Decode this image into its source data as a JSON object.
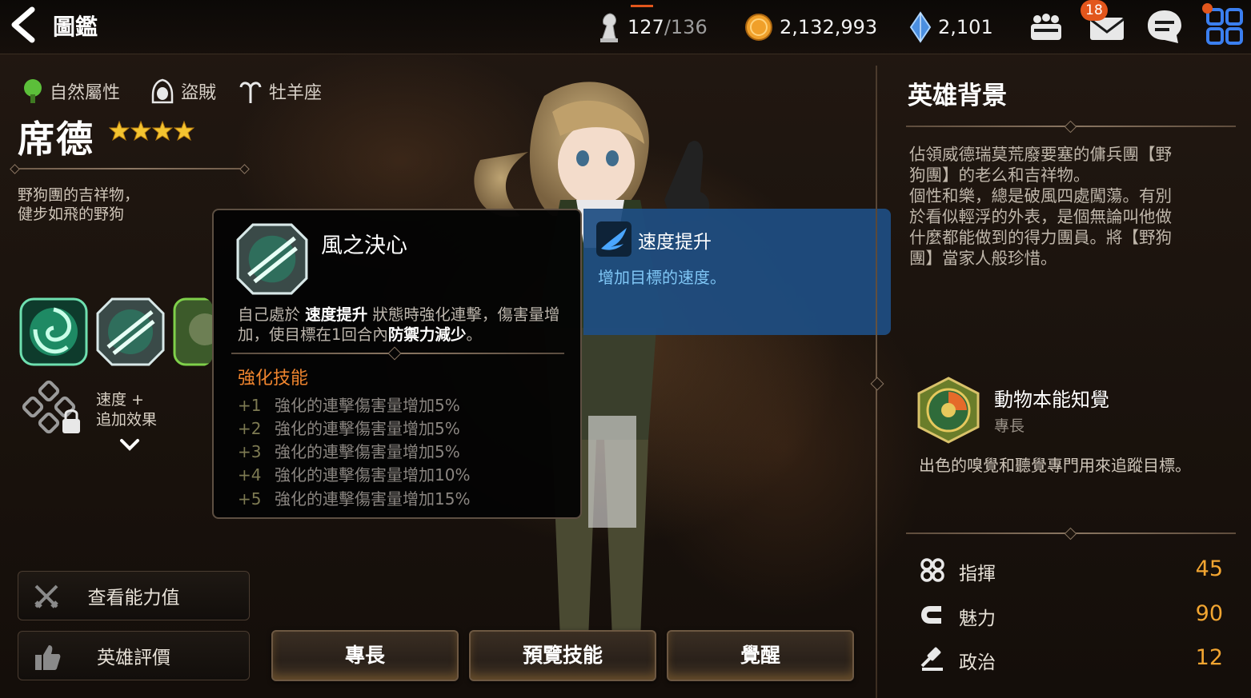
{
  "header": {
    "back_label": "back",
    "title": "圖鑑",
    "stamina": {
      "current": "127",
      "max": "/136"
    },
    "gold": "2,132,993",
    "crystal": "2,101",
    "mail_badge": "18"
  },
  "hero": {
    "attribute": "自然屬性",
    "class": "盜賊",
    "zodiac": "牡羊座",
    "name": "席德",
    "stars": 4,
    "tagline_lines": [
      "野狗團的吉祥物，",
      "健步如飛的野狗"
    ]
  },
  "skill_panel": {
    "buff_hint_lines": [
      "速度 +",
      "追加效果"
    ]
  },
  "side_buttons": {
    "stats": "查看能力值",
    "review": "英雄評價"
  },
  "bottom_tabs": {
    "specialty": "專長",
    "preview_skill": "預覽技能",
    "awaken": "覺醒"
  },
  "tooltip": {
    "skill_name": "風之決心",
    "desc_parts": {
      "p1": "自己處於 ",
      "b1": "速度提升",
      "p2": " 狀態時強化連擊，傷害量增加，使目標在1回合內",
      "b2": "防禦力減少",
      "p3": "。"
    },
    "enhance_title": "強化技能",
    "levels": [
      {
        "plus": "+1",
        "text": "強化的連擊傷害量增加5%"
      },
      {
        "plus": "+2",
        "text": "強化的連擊傷害量增加5%"
      },
      {
        "plus": "+3",
        "text": "強化的連擊傷害量增加5%"
      },
      {
        "plus": "+4",
        "text": "強化的連擊傷害量增加10%"
      },
      {
        "plus": "+5",
        "text": "強化的連擊傷害量增加15%"
      }
    ]
  },
  "buff_popup": {
    "title": "速度提升",
    "desc": "增加目標的速度。"
  },
  "right_panel": {
    "title": "英雄背景",
    "bio_lines": [
      "佔領威德瑞莫荒廢要塞的傭兵團【野",
      "狗團】的老么和吉祥物。",
      "個性和樂，總是破風四處闖蕩。有別",
      "於看似輕浮的外表，是個無論叫他做",
      "什麼都能做到的得力團員。將【野狗",
      "團】當家人般珍惜。"
    ],
    "specialty": {
      "name": "動物本能知覺",
      "type": "專長",
      "desc": "出色的嗅覺和聽覺專門用來追蹤目標。"
    },
    "stats": [
      {
        "name": "指揮",
        "value": "45"
      },
      {
        "name": "魅力",
        "value": "90"
      },
      {
        "name": "政治",
        "value": "12"
      }
    ]
  },
  "colors": {
    "accent_orange": "#f0852e",
    "stat_value": "#f2a531",
    "buff_blue": "#1e4e82",
    "badge": "#e2561c"
  }
}
